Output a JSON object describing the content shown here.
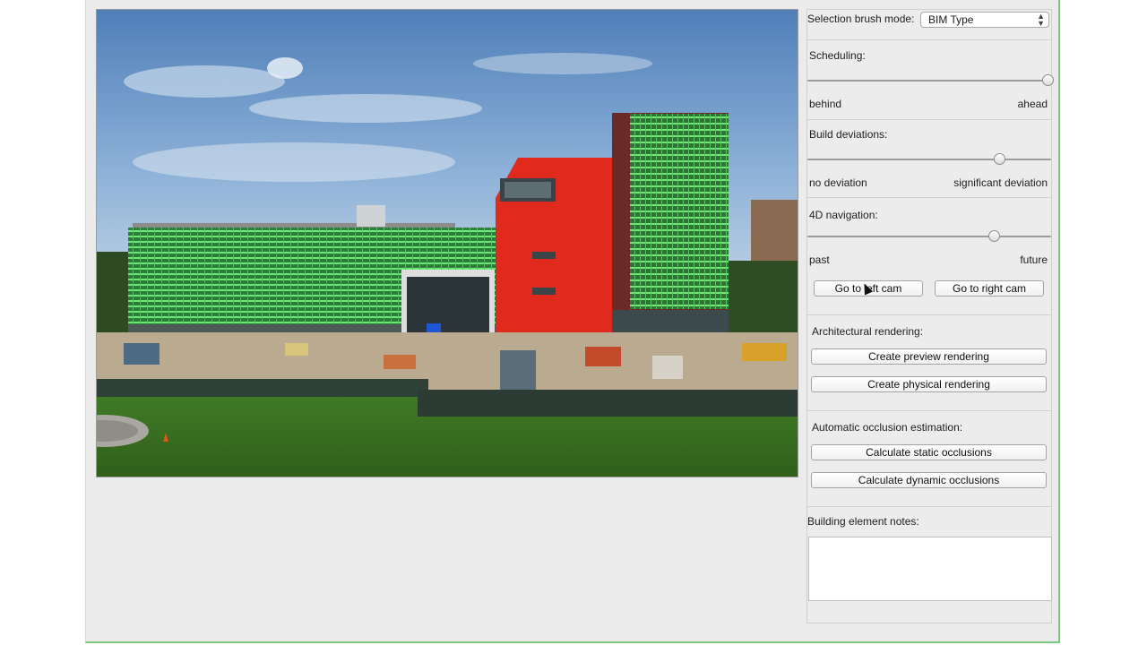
{
  "brush_mode": {
    "label": "Selection brush mode:",
    "value": "BIM Type"
  },
  "scheduling": {
    "label": "Scheduling:",
    "min_label": "behind",
    "max_label": "ahead",
    "level": 1.0
  },
  "deviations": {
    "label": "Build deviations:",
    "min_label": "no deviation",
    "max_label": "significant deviation",
    "level": 0.79
  },
  "navigation": {
    "label": "4D navigation:",
    "min_label": "past",
    "max_label": "future",
    "level": 0.77,
    "left_cam": "Go to left cam",
    "right_cam": "Go to right cam"
  },
  "rendering": {
    "label": "Architectural rendering:",
    "preview": "Create preview rendering",
    "physical": "Create physical rendering"
  },
  "occlusion": {
    "label": "Automatic occlusion estimation:",
    "static": "Calculate static occlusions",
    "dynamic": "Calculate dynamic occlusions"
  },
  "notes": {
    "label": "Building element notes:",
    "value": ""
  },
  "colors": {
    "overlay_green": "#58e26a",
    "overlay_red": "#e52a20",
    "panel_bg": "#ececec"
  }
}
